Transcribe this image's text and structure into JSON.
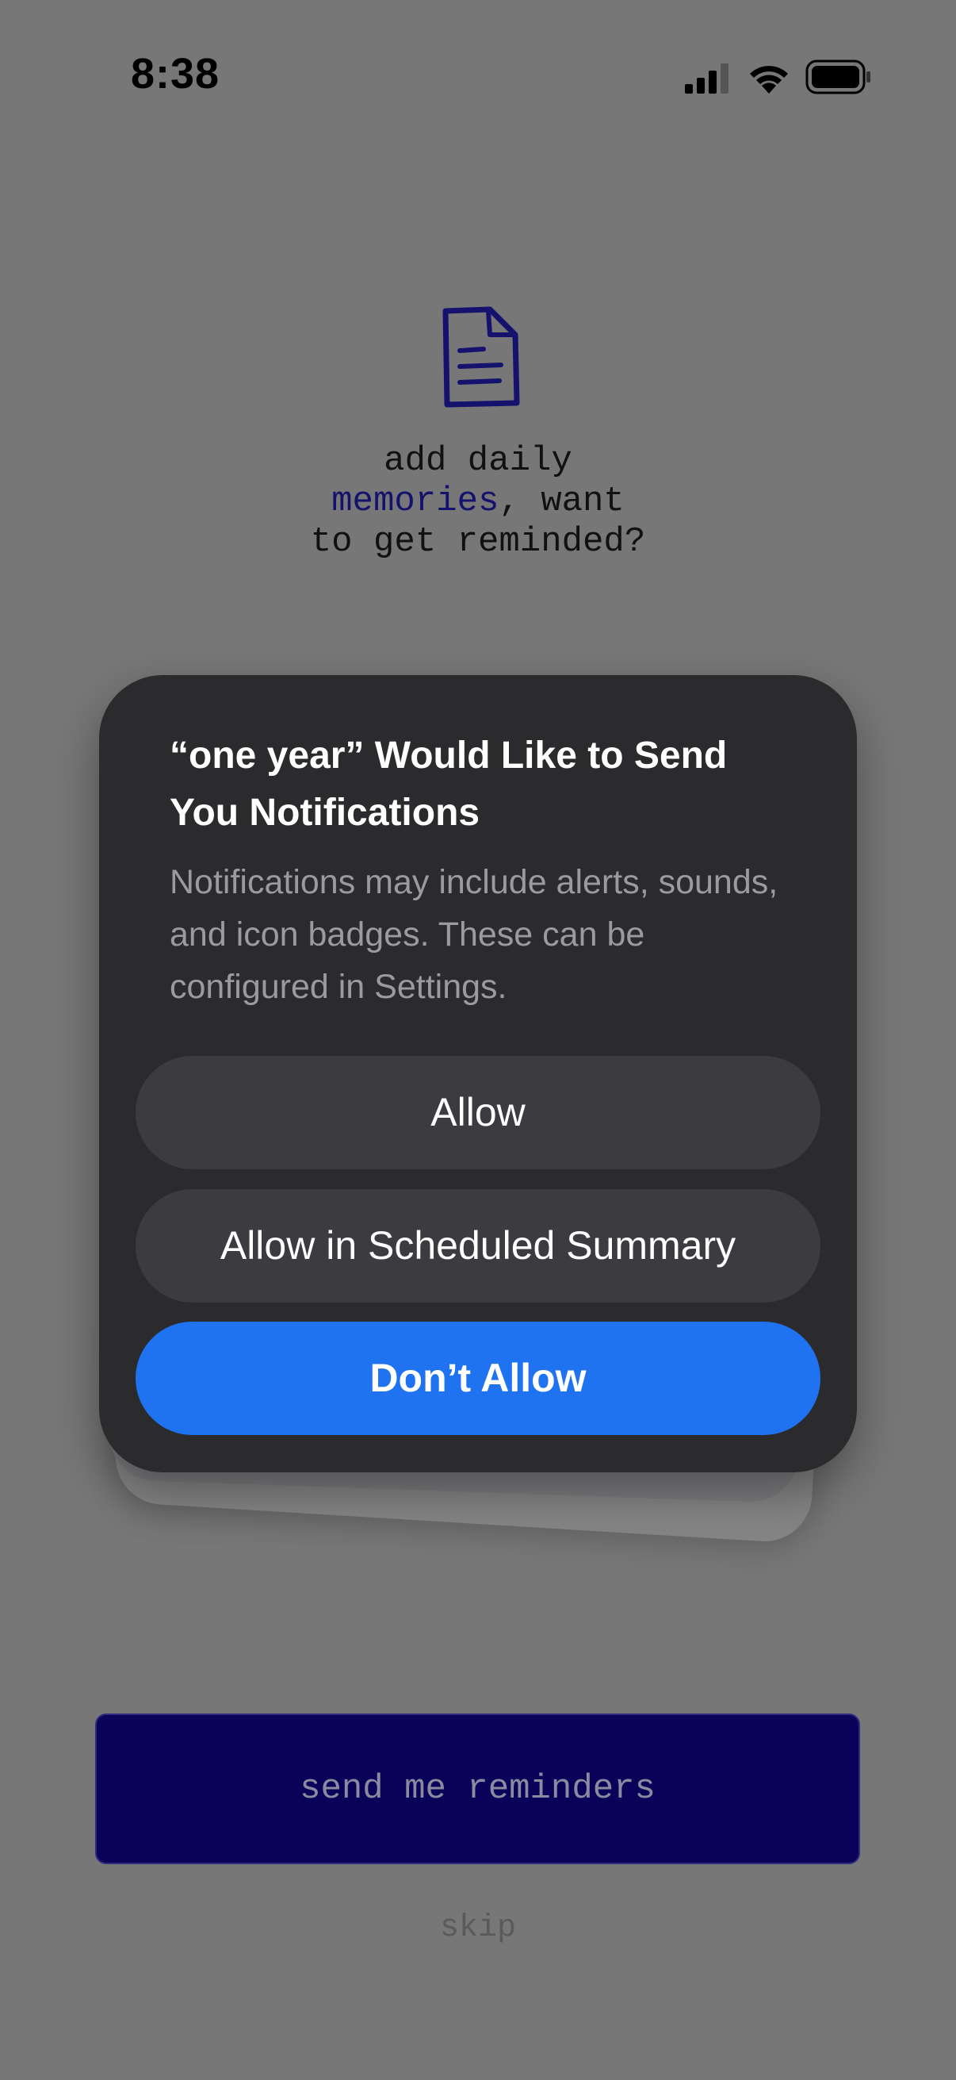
{
  "status_bar": {
    "time": "8:38",
    "icons": [
      "signal-icon",
      "wifi-icon",
      "battery-icon"
    ]
  },
  "onboarding": {
    "icon": "document-icon",
    "prompt_line1": "add daily",
    "prompt_accent": "memories",
    "prompt_after_accent": ", want",
    "prompt_line3": "to get reminded?",
    "accent_color": "#15126e"
  },
  "alert": {
    "title": "“one year” Would Like to Send You Notifications",
    "message": "Notifications may include alerts, sounds, and icon badges. These can be configured in Settings.",
    "buttons": {
      "allow": "Allow",
      "scheduled": "Allow in Scheduled Summary",
      "dont_allow": "Don’t Allow"
    },
    "primary_color": "#1f72f0"
  },
  "actions": {
    "send_reminders": "send me reminders",
    "skip": "skip",
    "button_color": "#0a0258"
  }
}
